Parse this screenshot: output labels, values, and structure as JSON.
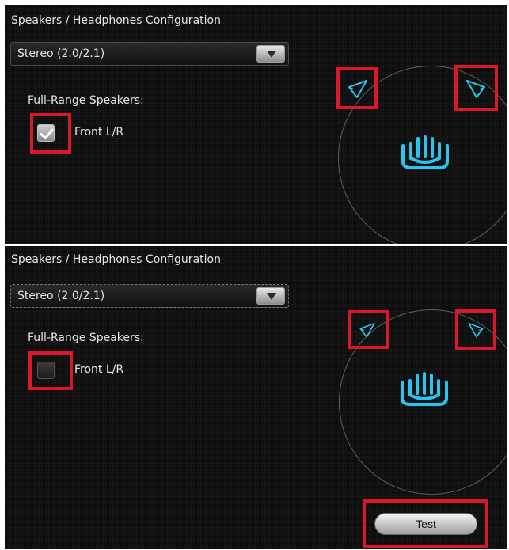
{
  "panels": [
    {
      "title": "Speakers / Headphones Configuration",
      "dropdown_value": "Stereo (2.0/2.1)",
      "section_label": "Full-Range Speakers:",
      "checkbox_label": "Front L/R",
      "checkbox_checked": true
    },
    {
      "title": "Speakers / Headphones Configuration",
      "dropdown_value": "Stereo (2.0/2.1)",
      "section_label": "Full-Range Speakers:",
      "checkbox_label": "Front L/R",
      "checkbox_checked": false,
      "test_button_label": "Test"
    }
  ],
  "icons": {
    "dropdown_arrow": "chevron-down-icon",
    "speaker_left": "speaker-left-icon",
    "speaker_right": "speaker-right-icon",
    "headset": "headset-icon",
    "checkmark": "checkmark-icon"
  },
  "colors": {
    "background": "#0d0d0d",
    "accent": "#27c6f0",
    "highlight": "#d9182a",
    "text": "#e6e6e6"
  }
}
